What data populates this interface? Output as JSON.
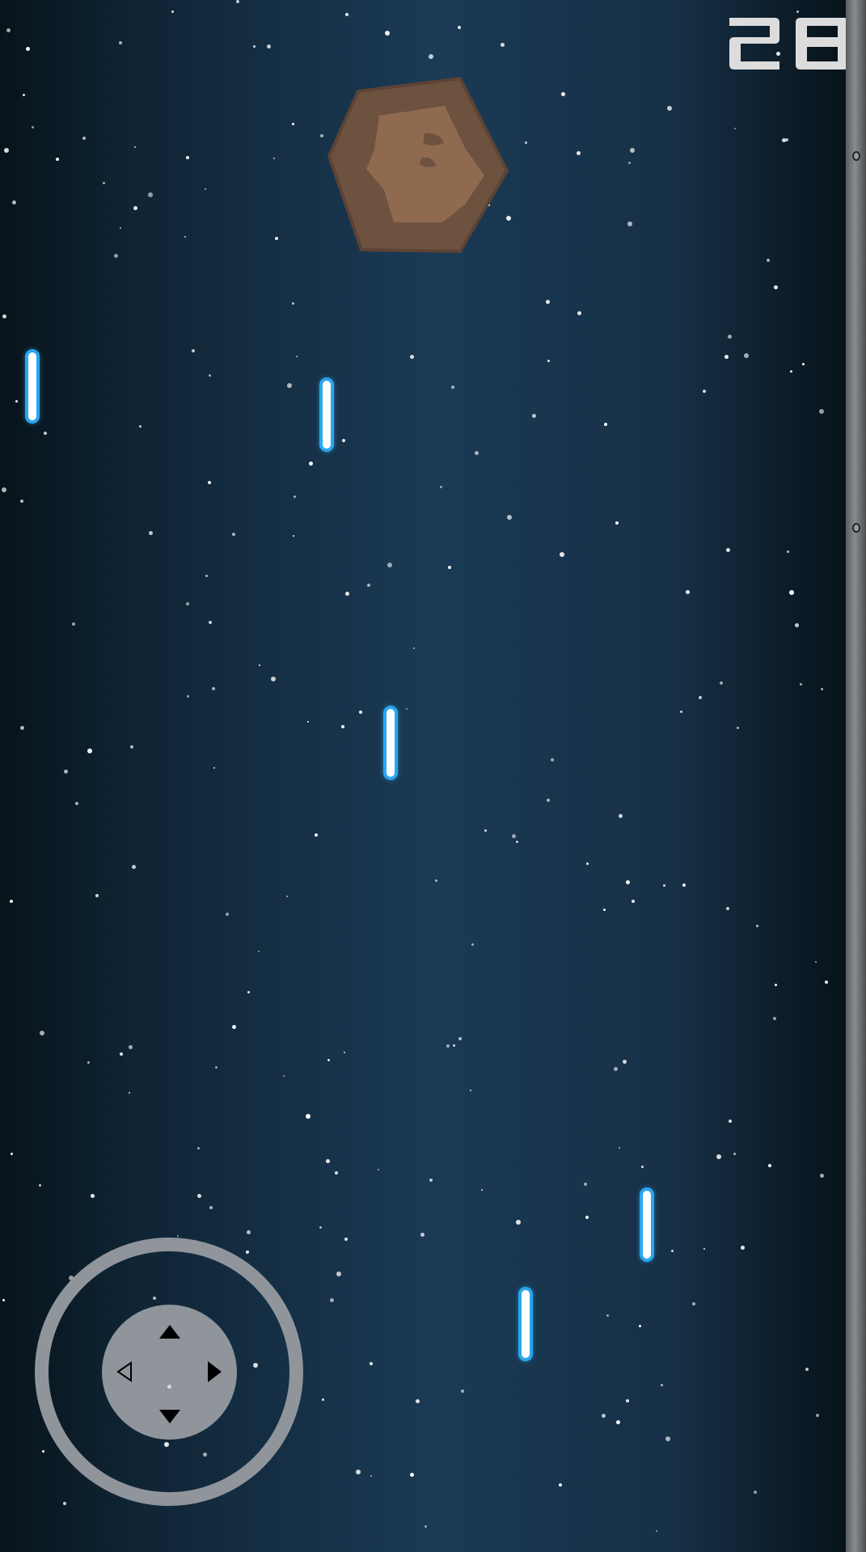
{
  "hud": {
    "score": "28"
  },
  "colors": {
    "laser_core": "#ffffff",
    "laser_glow": "#29a7ef",
    "asteroid_outer": "#6e5240",
    "asteroid_inner": "#8f6a4f",
    "joystick": "#8f959b",
    "score_digit": "#dcdcdc"
  },
  "controls": {
    "joystick_icons": [
      "arrow-up-icon",
      "arrow-down-icon",
      "arrow-left-icon",
      "arrow-right-icon"
    ]
  }
}
